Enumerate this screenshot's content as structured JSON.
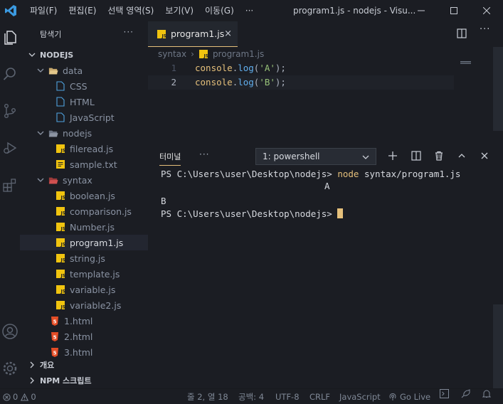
{
  "titlebar": {
    "menus": [
      "파일(F)",
      "편집(E)",
      "선택 영역(S)",
      "보기(V)",
      "이동(G)",
      "···"
    ],
    "window_title": "program1.js - nodejs - Visu..."
  },
  "sidebar": {
    "title": "탐색기",
    "more": "···",
    "root": "NODEJS",
    "items": [
      {
        "label": "data",
        "kind": "folder-open"
      },
      {
        "label": "CSS",
        "kind": "file"
      },
      {
        "label": "HTML",
        "kind": "file"
      },
      {
        "label": "JavaScript",
        "kind": "file"
      },
      {
        "label": "nodejs",
        "kind": "folder-open"
      },
      {
        "label": "fileread.js",
        "kind": "js"
      },
      {
        "label": "sample.txt",
        "kind": "txt"
      },
      {
        "label": "syntax",
        "kind": "folder-open-red"
      },
      {
        "label": "boolean.js",
        "kind": "js"
      },
      {
        "label": "comparison.js",
        "kind": "js"
      },
      {
        "label": "Number.js",
        "kind": "js"
      },
      {
        "label": "program1.js",
        "kind": "js",
        "selected": true
      },
      {
        "label": "string.js",
        "kind": "js"
      },
      {
        "label": "template.js",
        "kind": "js"
      },
      {
        "label": "variable.js",
        "kind": "js"
      },
      {
        "label": "variable2.js",
        "kind": "js"
      },
      {
        "label": "1.html",
        "kind": "html"
      },
      {
        "label": "2.html",
        "kind": "html"
      },
      {
        "label": "3.html",
        "kind": "html"
      }
    ],
    "outline": "개요",
    "npm_scripts": "NPM 스크립트"
  },
  "editor": {
    "tab_label": "program1.js",
    "close": "×",
    "breadcrumb": {
      "folder": "syntax",
      "sep": "›",
      "file": "program1.js"
    },
    "lines": [
      {
        "num": "1",
        "text": "console.log('A');"
      },
      {
        "num": "2",
        "text": "console.log('B');"
      }
    ]
  },
  "terminal": {
    "tab_label": "터미널",
    "more": "···",
    "shell": "1: powershell",
    "lines": [
      {
        "prompt": "PS C:\\Users\\user\\Desktop\\nodejs> ",
        "cmd": "node",
        "args": " syntax/program1.js"
      },
      {
        "output": "A"
      },
      {
        "output": ""
      },
      {
        "output": "B"
      },
      {
        "prompt": "PS C:\\Users\\user\\Desktop\\nodejs> "
      }
    ]
  },
  "status": {
    "errors": "0",
    "warnings": "0",
    "position": "줄 2, 열 18",
    "spaces": "공백: 4",
    "encoding": "UTF-8",
    "eol": "CRLF",
    "language": "JavaScript",
    "golive": "Go Live"
  },
  "colors": {
    "accent": "#e5c07b",
    "js_icon": "#f1c40f",
    "html_icon": "#e44d26",
    "folder": "#c8a96e"
  }
}
